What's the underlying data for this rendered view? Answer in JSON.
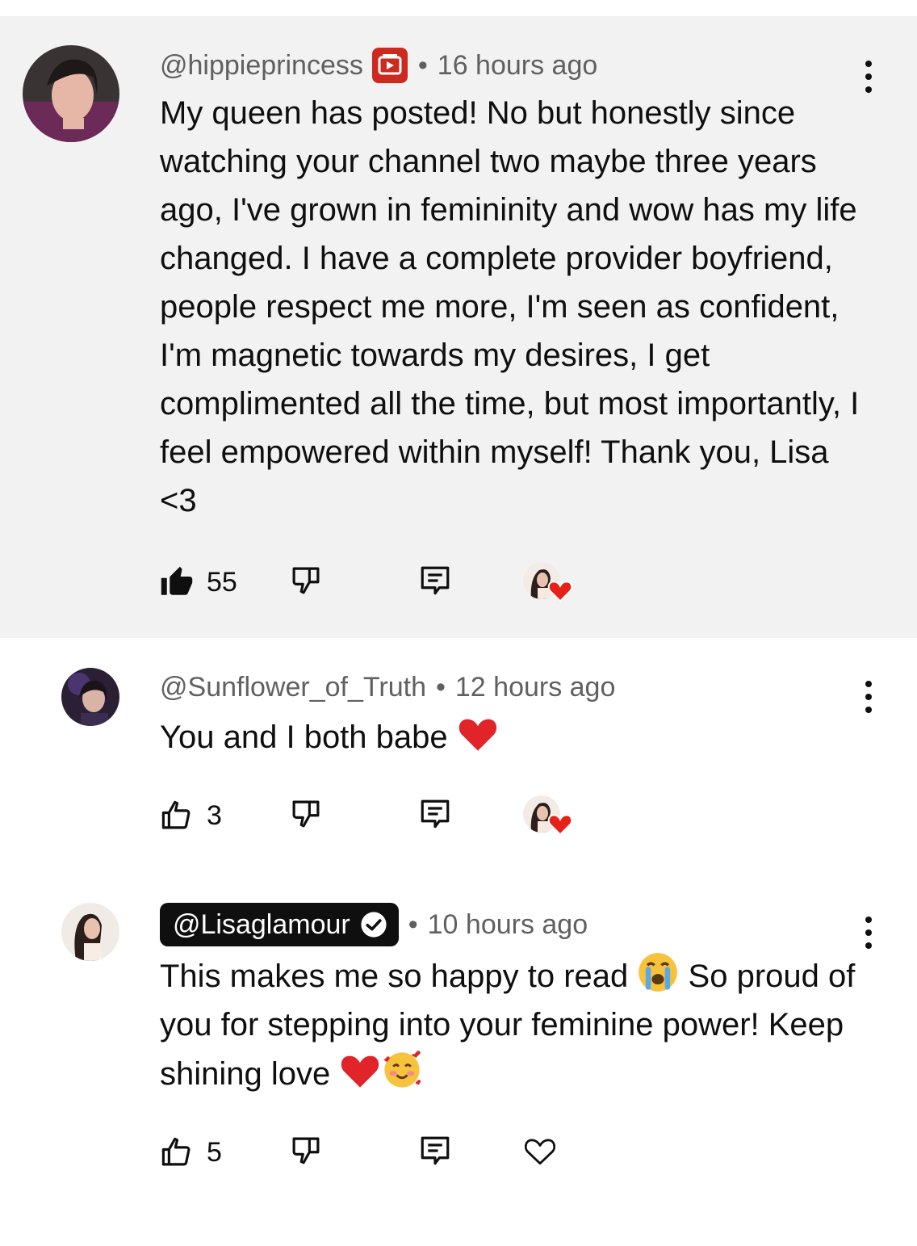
{
  "comments": [
    {
      "author": "@hippieprincess",
      "time": "16 hours ago",
      "text": "My queen has posted! No but honestly since watching your channel two maybe three years ago, I've grown in femininity and wow has my life changed. I have a complete provider boyfriend, people respect me more, I'm seen as confident, I'm magnetic towards my desires, I get complimented all the time, but most importantly, I feel empowered within myself! Thank you, Lisa <3",
      "likes": "55",
      "liked": true,
      "hearted_by_creator": true,
      "member_badge": "membership-badge-icon"
    },
    {
      "author": "@Sunflower_of_Truth",
      "time": "12 hours ago",
      "text": "You and I both babe",
      "text_emoji": "red-heart",
      "likes": "3",
      "liked": false,
      "hearted_by_creator": true
    },
    {
      "author": "@Lisaglamour",
      "time": "10 hours ago",
      "text_part1": "This makes me so happy to read",
      "text_part2": "So proud of you for stepping into your feminine power! Keep shining love",
      "emojis": [
        "loudly-crying-face",
        "red-heart",
        "smiling-face-with-hearts"
      ],
      "likes": "5",
      "liked": false,
      "verified": true,
      "creator": true,
      "hearted_by_creator": false
    }
  ],
  "separator": "•",
  "colors": {
    "highlight_bg": "#f2f2f2",
    "secondary_text": "#606060",
    "heart_red": "#e62117",
    "member_badge_red": "#cc2a1f"
  }
}
